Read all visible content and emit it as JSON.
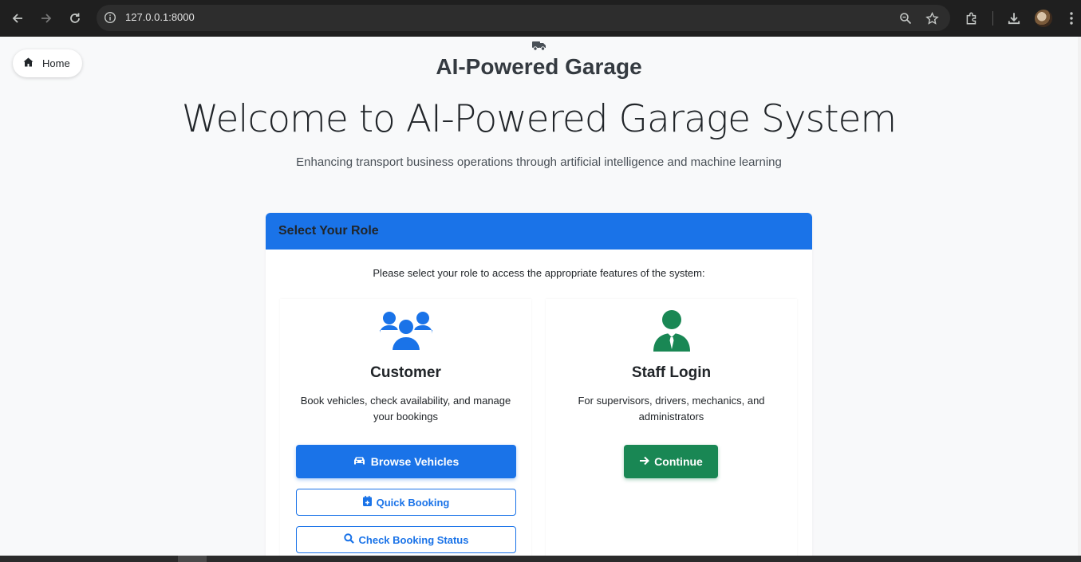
{
  "browser": {
    "url": "127.0.0.1:8000",
    "icons": [
      "back-icon",
      "forward-icon",
      "reload-icon",
      "site-info-icon",
      "zoom-icon",
      "bookmark-star-icon",
      "extensions-icon",
      "download-icon",
      "profile-avatar",
      "menu-icon"
    ]
  },
  "nav": {
    "home_label": "Home"
  },
  "header": {
    "brand": "AI-Powered Garage",
    "title": "Welcome to AI-Powered Garage System",
    "subtitle": "Enhancing transport business operations through artificial intelligence and machine learning"
  },
  "role_card": {
    "header": "Select Your Role",
    "intro": "Please select your role to access the appropriate features of the system:",
    "customer": {
      "title": "Customer",
      "description": "Book vehicles, check availability, and manage your bookings",
      "browse_label": "Browse Vehicles",
      "quick_booking_label": "Quick Booking",
      "check_status_label": "Check Booking Status"
    },
    "staff": {
      "title": "Staff Login",
      "description": "For supervisors, drivers, mechanics, and administrators",
      "continue_label": "Continue"
    }
  },
  "colors": {
    "primary": "#1a73e8",
    "success": "#198754",
    "background": "#f8f9fa"
  }
}
